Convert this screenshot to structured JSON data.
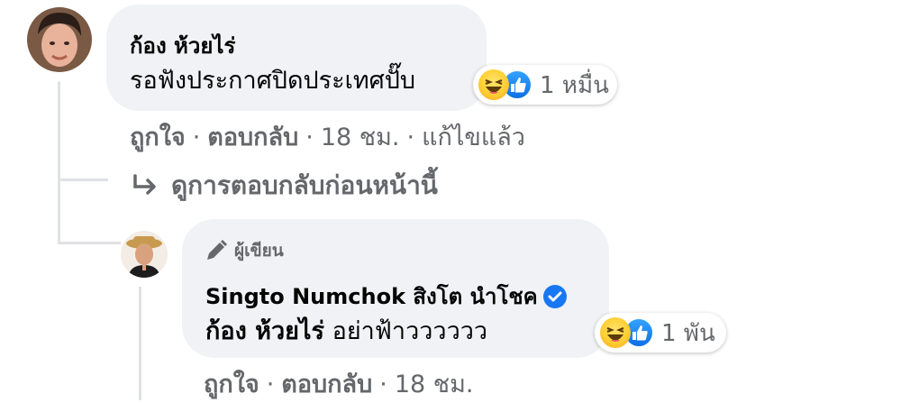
{
  "comment": {
    "author": "ก้อง ห้วยไร่",
    "text": "รอฟังประกาศปิดประเทศปั๊บ",
    "reaction_count": "1 หมื่น",
    "actions": {
      "like": "ถูกใจ",
      "reply": "ตอบกลับ",
      "time": "18 ชม.",
      "edited": "แก้ไขแล้ว"
    },
    "view_previous": "ดูการตอบกลับก่อนหน้านี้"
  },
  "reply": {
    "badge": "ผู้เขียน",
    "author": "Singto Numchok สิงโต นำโชค",
    "mention": "ก้อง ห้วยไร่",
    "text": "อย่าฟ้าวววววว",
    "reaction_count": "1 พัน",
    "actions": {
      "like": "ถูกใจ",
      "reply": "ตอบกลับ",
      "time": "18 ชม."
    }
  },
  "icons": [
    "haha-reaction-icon",
    "like-reaction-icon",
    "pencil-icon",
    "verified-icon",
    "reply-arrow-icon"
  ],
  "colors": {
    "bubble": "#f0f2f5",
    "meta_text": "#65676b",
    "like_blue": "#1877f2",
    "haha_yellow": "#ffce32"
  }
}
